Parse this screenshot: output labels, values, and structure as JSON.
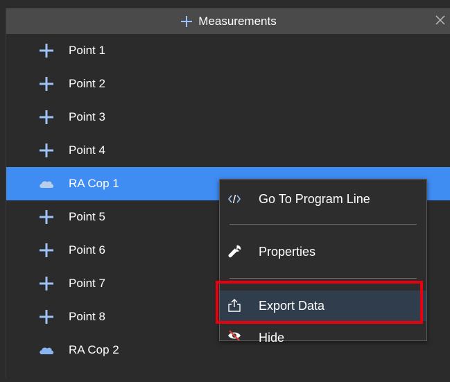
{
  "panel": {
    "title": "Measurements",
    "title_icon": "plus-icon",
    "close_icon": "close-icon"
  },
  "items": [
    {
      "label": "Point 1",
      "icon": "plus-icon"
    },
    {
      "label": "Point 2",
      "icon": "plus-icon"
    },
    {
      "label": "Point 3",
      "icon": "plus-icon"
    },
    {
      "label": "Point 4",
      "icon": "plus-icon"
    },
    {
      "label": "RA Cop 1",
      "icon": "cloud-icon",
      "selected": true
    },
    {
      "label": "Point 5",
      "icon": "plus-icon"
    },
    {
      "label": "Point 6",
      "icon": "plus-icon"
    },
    {
      "label": "Point 7",
      "icon": "plus-icon"
    },
    {
      "label": "Point 8",
      "icon": "plus-icon"
    },
    {
      "label": "RA Cop 2",
      "icon": "cloud-icon"
    }
  ],
  "context_menu": {
    "items": [
      {
        "label": "Go To Program Line",
        "icon": "code-icon"
      },
      {
        "label": "Properties",
        "icon": "wrench-icon"
      },
      {
        "label": "Export Data",
        "icon": "export-icon",
        "highlighted": true
      },
      {
        "label": "Hide",
        "icon": "eye-slash-icon"
      }
    ]
  },
  "colors": {
    "selection": "#3f8cf3",
    "highlight_border": "#e8000e",
    "icon_blue": "#8ab4f0",
    "background": "#2b2b2b"
  }
}
